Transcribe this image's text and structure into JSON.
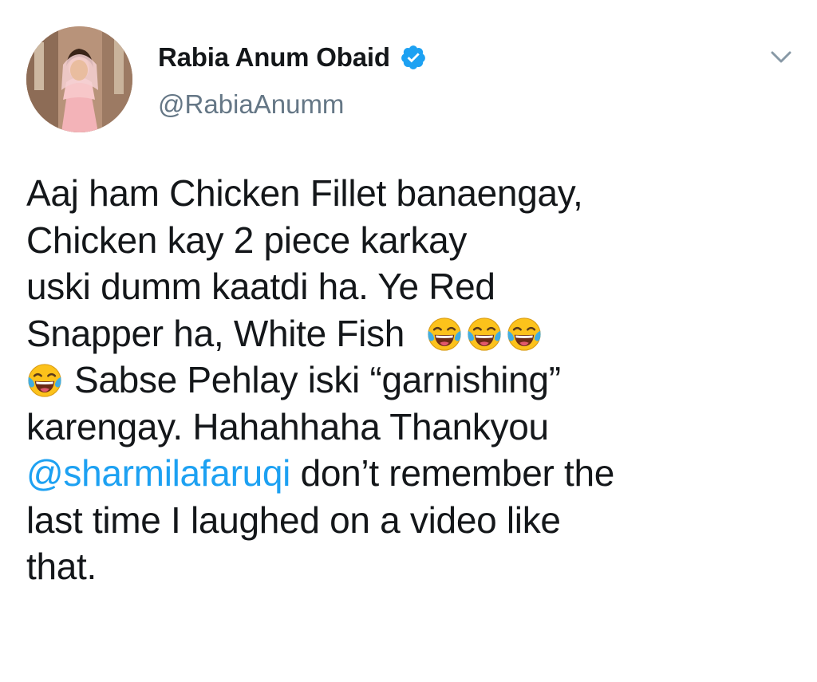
{
  "tweet": {
    "author": {
      "display_name": "Rabia Anum Obaid",
      "handle": "@RabiaAnumm",
      "verified": true,
      "avatar_icon": "profile-photo"
    },
    "menu_icon": "chevron-down-icon",
    "lines": {
      "l1": "Aaj ham Chicken Fillet banaengay,",
      "l2": "Chicken kay 2 piece karkay",
      "l3": "uski dumm kaatdi ha. Ye Red",
      "l4": "Snapper ha, White Fish",
      "l5": "Sabse Pehlay iski “garnishing”",
      "l6": "karengay. Hahahhaha Thankyou",
      "mention": "@sharmilafaruqi",
      "l7_rest": " don’t remember the",
      "l8": "last time I laughed on a video like",
      "l9": "that."
    },
    "emojis": [
      "face-with-tears-of-joy",
      "face-with-tears-of-joy",
      "face-with-tears-of-joy",
      "face-with-tears-of-joy"
    ]
  },
  "colors": {
    "text": "#14171a",
    "secondary": "#657786",
    "link": "#1da1f2",
    "verified_badge": "#1da1f2",
    "emoji_face": "#fcc21b",
    "emoji_tears": "#42ade2"
  }
}
